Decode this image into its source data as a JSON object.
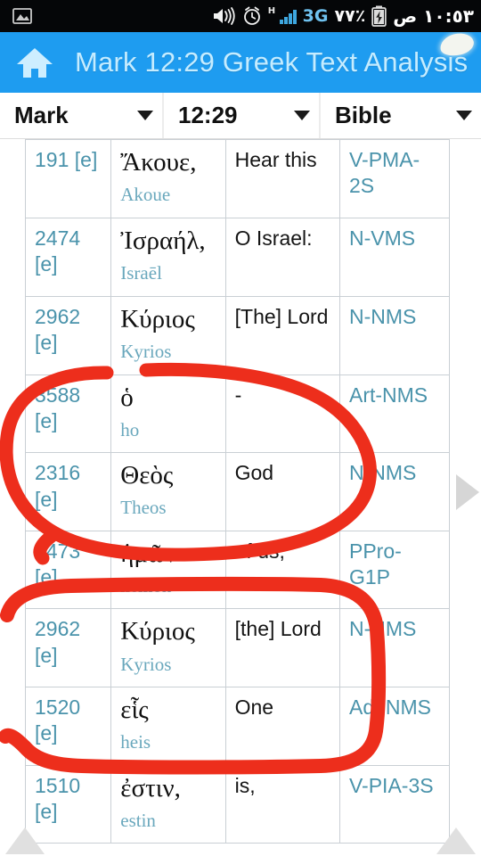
{
  "status_bar": {
    "gallery_icon": "image-icon",
    "volume_icon": "volume-icon",
    "alarm_icon": "alarm-clock-icon",
    "hspa_label": "H",
    "signal_icon": "signal-bars-icon",
    "network_label": "3G",
    "battery_percent": "٧٧٪",
    "battery_icon": "battery-charging-icon",
    "time": "١٠:٥٣ ص"
  },
  "app_bar": {
    "home_icon": "home-icon",
    "title": "Mark 12:29 Greek Text Analysis",
    "background_color": "#1e9cf0",
    "title_color": "#c5ecff"
  },
  "selectors": [
    {
      "name": "book",
      "value": "Mark"
    },
    {
      "name": "reference",
      "value": "12:29"
    },
    {
      "name": "version",
      "value": "Bible"
    }
  ],
  "table": {
    "columns": [
      "strongs",
      "greek",
      "english",
      "parsing"
    ],
    "rows": [
      {
        "strongs": "191 [e]",
        "greek": "Ἄκουε,",
        "translit": "Akoue",
        "english": "Hear this",
        "parsing": "V-PMA-2S"
      },
      {
        "strongs": "2474 [e]",
        "greek": "Ἰσραήλ,",
        "translit": "Israēl",
        "english": "O Israel:",
        "parsing": "N-VMS"
      },
      {
        "strongs": "2962 [e]",
        "greek": "Κύριος",
        "translit": "Kyrios",
        "english": "[The] Lord",
        "parsing": "N-NMS"
      },
      {
        "strongs": "3588 [e]",
        "greek": "ὁ",
        "translit": "ho",
        "english": "-",
        "parsing": "Art-NMS"
      },
      {
        "strongs": "2316 [e]",
        "greek": "Θεὸς",
        "translit": "Theos",
        "english": "God",
        "parsing": "N-NMS"
      },
      {
        "strongs": "1473 [e]",
        "greek": "ἡμῶν",
        "translit": "hēmōn",
        "english": "of us,",
        "parsing": "PPro-G1P"
      },
      {
        "strongs": "2962 [e]",
        "greek": "Κύριος",
        "translit": "Kyrios",
        "english": "[the] Lord",
        "parsing": "N-NMS"
      },
      {
        "strongs": "1520 [e]",
        "greek": "εἷς",
        "translit": "heis",
        "english": "One",
        "parsing": "Adj-NMS"
      },
      {
        "strongs": "1510 [e]",
        "greek": "ἐστιν,",
        "translit": "estin",
        "english": "is,",
        "parsing": "V-PIA-3S"
      }
    ]
  },
  "annotations": {
    "color": "#ed2e1c",
    "marks": [
      {
        "name": "circle-ho-theos",
        "shape": "oval",
        "covers": "rows 4-5"
      },
      {
        "name": "circle-kyrios-heis",
        "shape": "rounded-rect",
        "covers": "rows 7-8"
      }
    ]
  },
  "navigation": {
    "next_arrow_icon": "triangle-right-icon",
    "scroll_up_left_icon": "triangle-up-icon",
    "scroll_up_right_icon": "triangle-up-icon"
  }
}
